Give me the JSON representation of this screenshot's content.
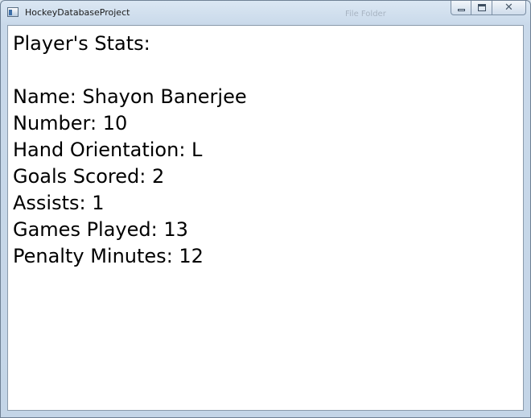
{
  "window": {
    "title": "HockeyDatabaseProject",
    "background_text": [
      "File Folder"
    ]
  },
  "stats": {
    "heading": "Player's Stats:",
    "name": "Name: Shayon Banerjee",
    "number": "Number: 10",
    "hand_orientation": "Hand Orientation: L",
    "goals_scored": "Goals Scored: 2",
    "assists": "Assists: 1",
    "games_played": "Games Played: 13",
    "penalty_minutes": "Penalty Minutes: 12"
  },
  "icons": {
    "app": "window-app-icon",
    "minimize": "minimize-icon",
    "maximize": "maximize-icon",
    "close": "close-icon"
  }
}
